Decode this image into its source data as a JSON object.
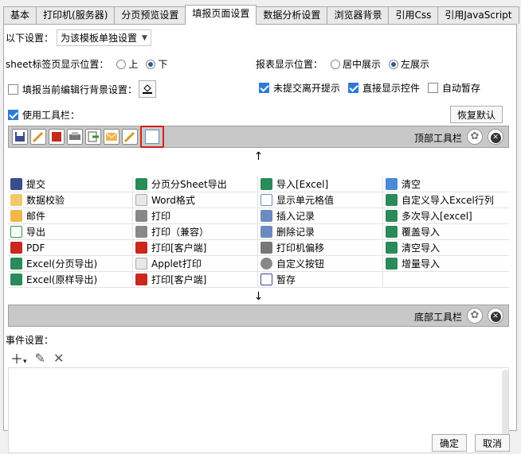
{
  "tabs": [
    "基本",
    "打印机(服务器)",
    "分页预览设置",
    "填报页面设置",
    "数据分析设置",
    "浏览器背景",
    "引用Css",
    "引用JavaScript"
  ],
  "settings": {
    "following_label": "以下设置：",
    "following_value": "为该模板单独设置",
    "sheet_label": "sheet标签页显示位置：",
    "sheet_opt_top": "上",
    "sheet_opt_bottom": "下",
    "report_label": "报表显示位置：",
    "report_opt_center": "居中展示",
    "report_opt_left": "左展示",
    "fill_bg": "填报当前编辑行背景设置：",
    "unsubmitted": "未提交离开提示",
    "direct_show": "直接显示控件",
    "auto_save": "自动暂存",
    "use_toolbar": "使用工具栏：",
    "restore": "恢复默认"
  },
  "top_toolbar_label": "顶部工具栏",
  "bottom_toolbar_label": "底部工具栏",
  "up_arrow": "↑",
  "down_arrow": "↓",
  "button_grid": [
    [
      "提交",
      "分页分Sheet导出",
      "导入[Excel]",
      "清空"
    ],
    [
      "数据校验",
      "Word格式",
      "显示单元格值",
      "自定义导入Excel行列"
    ],
    [
      "邮件",
      "打印",
      "插入记录",
      "多次导入[excel]"
    ],
    [
      "导出",
      "打印（兼容）",
      "删除记录",
      "覆盖导入"
    ],
    [
      "PDF",
      "打印[客户端]",
      "打印机偏移",
      "清空导入"
    ],
    [
      "Excel(分页导出)",
      "Applet打印",
      "自定义按钮",
      "增量导入"
    ],
    [
      "Excel(原样导出)",
      "打印[客户端]",
      "暂存",
      ""
    ]
  ],
  "event_label": "事件设置：",
  "ok": "确定",
  "cancel": "取消"
}
